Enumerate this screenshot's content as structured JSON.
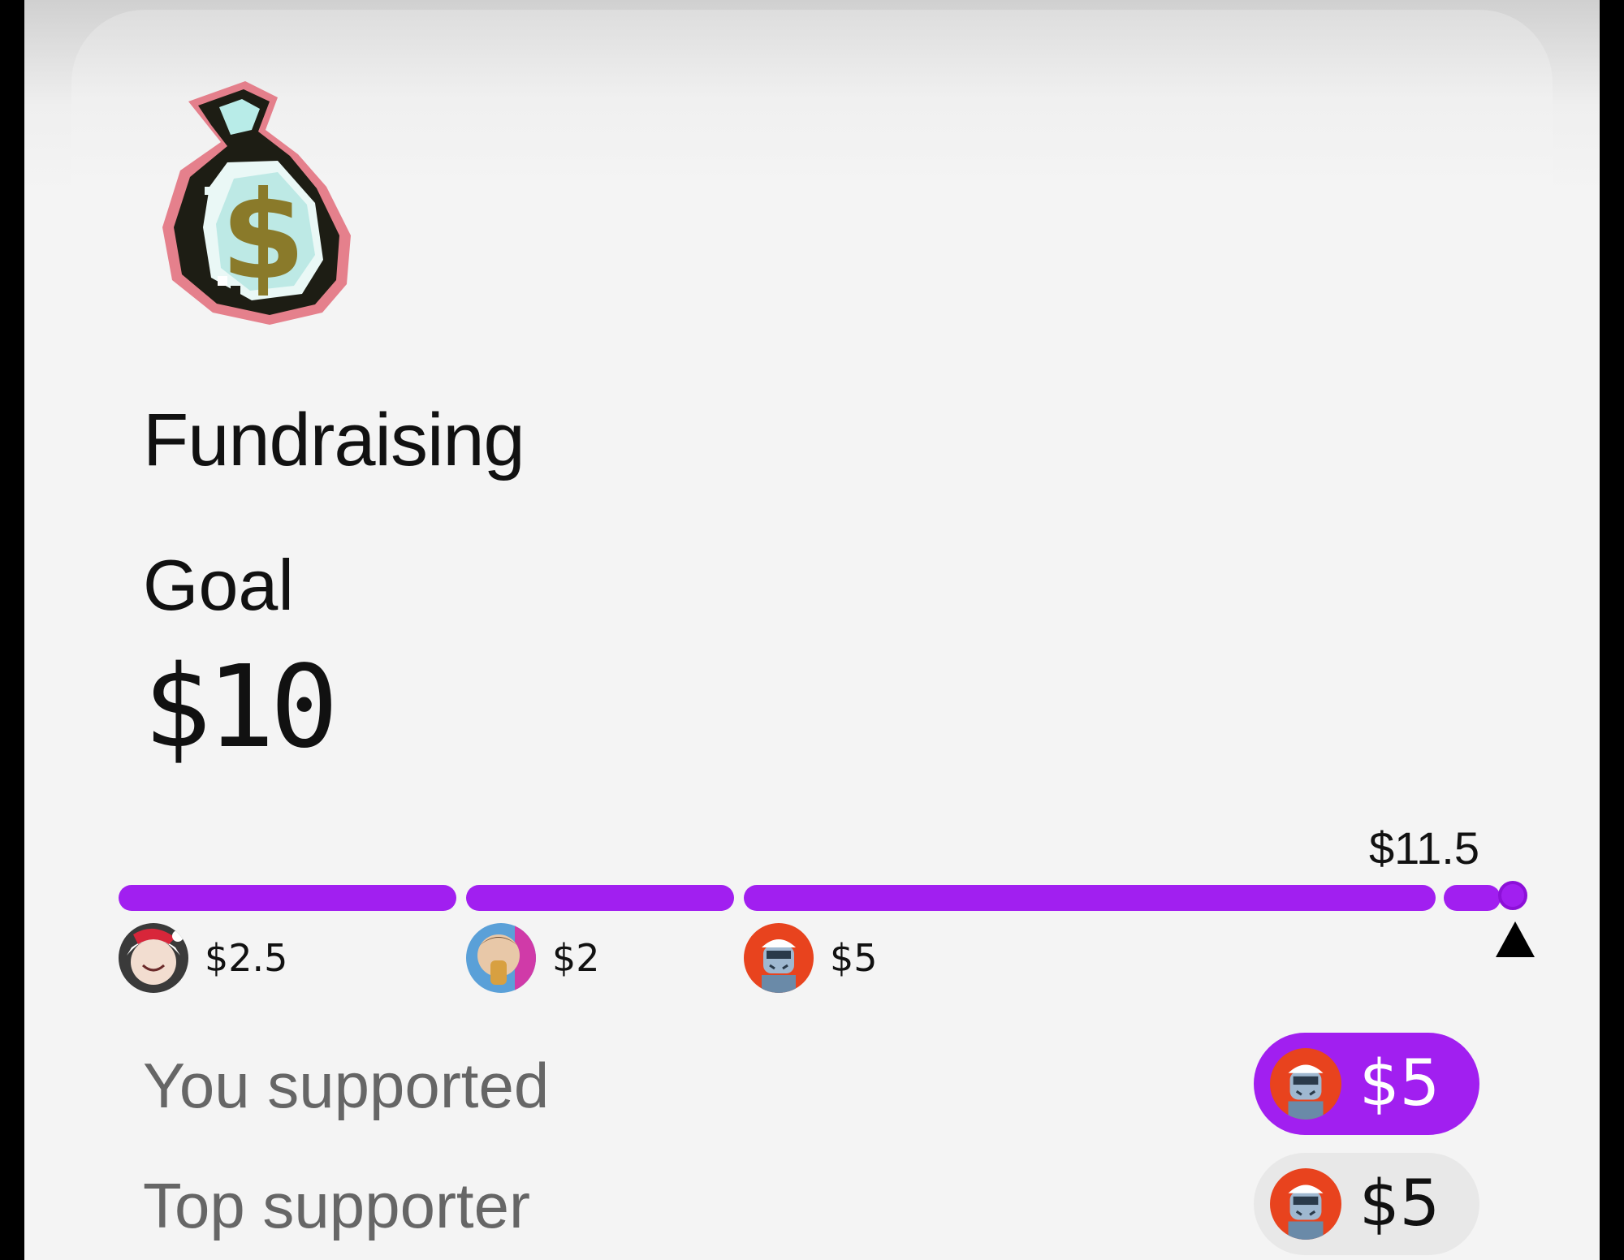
{
  "card": {
    "icon": "money-bag-icon",
    "title": "Fundraising",
    "goal_label": "Goal",
    "goal_value": "$10",
    "total_raised": "$11.5"
  },
  "progress": {
    "total": 11.5,
    "goal": 10,
    "bar_color": "#a11ff0",
    "contributions": [
      {
        "amount": "$2.5",
        "value": 2.5,
        "avatar": "anime-avatar-icon"
      },
      {
        "amount": "$2",
        "value": 2,
        "avatar": "child-avatar-icon"
      },
      {
        "amount": "$5",
        "value": 5,
        "avatar": "robot-avatar-icon"
      }
    ]
  },
  "you_supported": {
    "label": "You supported",
    "amount": "$5",
    "avatar": "robot-avatar-icon"
  },
  "top_supporter": {
    "label": "Top supporter",
    "amount": "$5",
    "avatar": "robot-avatar-icon"
  }
}
